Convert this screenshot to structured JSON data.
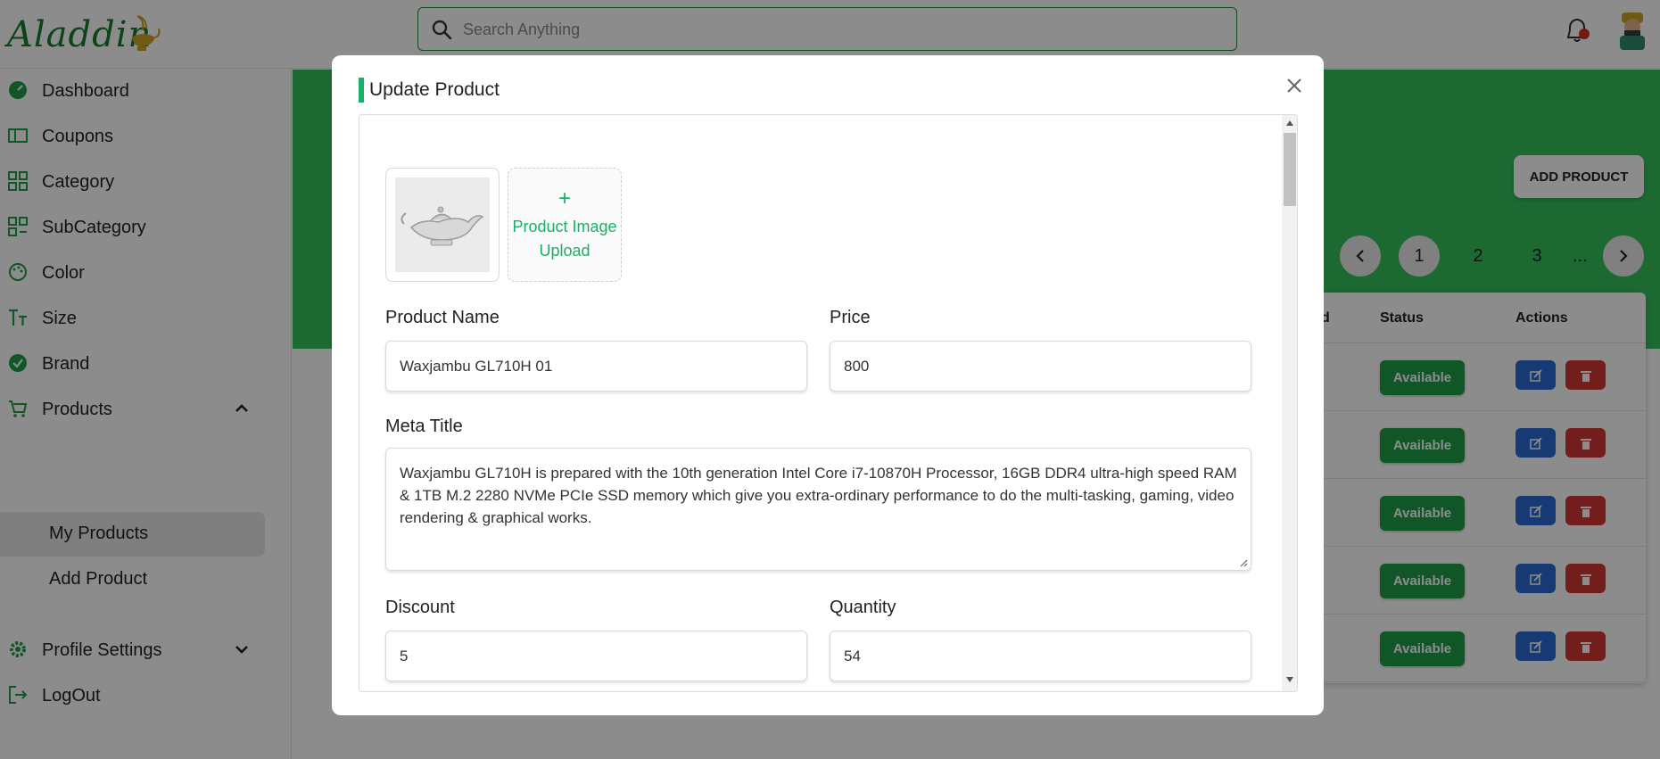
{
  "app": {
    "logo_text": "Aladdin",
    "search_placeholder": "Search Anything"
  },
  "sidebar": {
    "items": [
      {
        "label": "Dashboard",
        "icon": "dashboard-icon"
      },
      {
        "label": "Coupons",
        "icon": "coupon-icon"
      },
      {
        "label": "Category",
        "icon": "category-icon"
      },
      {
        "label": "SubCategory",
        "icon": "subcategory-icon"
      },
      {
        "label": "Color",
        "icon": "palette-icon"
      },
      {
        "label": "Size",
        "icon": "text-size-icon"
      },
      {
        "label": "Brand",
        "icon": "verified-badge-icon"
      },
      {
        "label": "Products",
        "icon": "cart-icon"
      },
      {
        "label": "Profile Settings",
        "icon": "gear-icon"
      },
      {
        "label": "LogOut",
        "icon": "logout-icon"
      }
    ],
    "product_sub": [
      "My Products",
      "Add Product"
    ]
  },
  "main": {
    "add_product_label": "ADD PRODUCT",
    "pager": {
      "pages": [
        "1",
        "2",
        "3"
      ],
      "dots": "...",
      "current": "1"
    },
    "table": {
      "headers": [
        "d",
        "Status",
        "Actions"
      ],
      "rows": [
        {
          "status": "Available"
        },
        {
          "status": "Available"
        },
        {
          "status": "Available"
        },
        {
          "status": "Available"
        },
        {
          "status": "Available"
        }
      ]
    }
  },
  "modal": {
    "title": "Update Product",
    "upload_plus": "+",
    "upload_label": "Product Image Upload",
    "fields": {
      "product_name_label": "Product Name",
      "product_name_value": "Waxjambu GL710H 01",
      "price_label": "Price",
      "price_value": "800",
      "meta_title_label": "Meta Title",
      "meta_title_value": "Waxjambu GL710H is prepared with the 10th generation Intel Core i7-10870H Processor, 16GB DDR4 ultra-high speed RAM & 1TB M.2 2280 NVMe PCIe SSD memory which give you extra-ordinary performance to do the multi-tasking, gaming, video rendering & graphical works.",
      "discount_label": "Discount",
      "discount_value": "5",
      "quantity_label": "Quantity",
      "quantity_value": "54"
    }
  },
  "colors": {
    "brand_green": "#34c05b",
    "accent_teal": "#18b06a",
    "status_green": "#1f9d45",
    "edit_blue": "#2a6ad6",
    "delete_red": "#d43535"
  }
}
